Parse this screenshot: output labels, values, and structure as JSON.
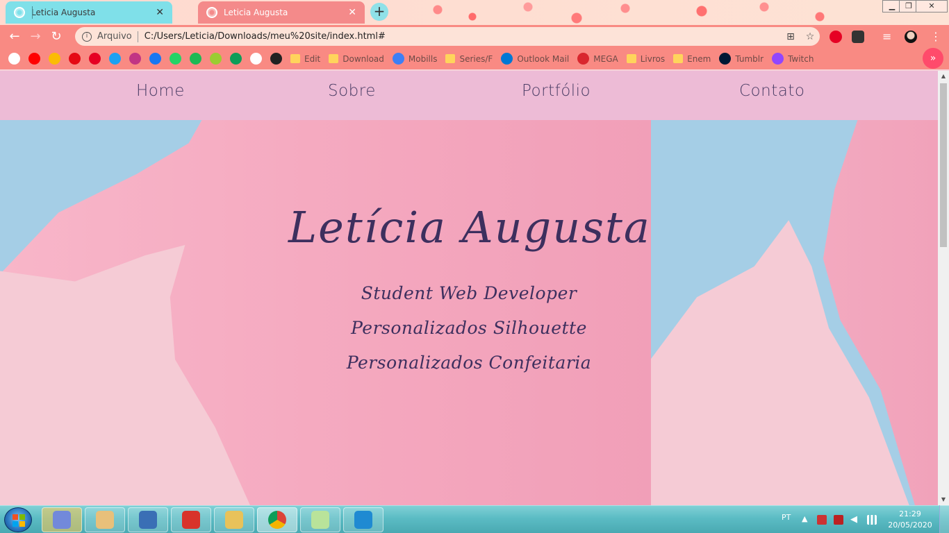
{
  "browser": {
    "tabs": [
      {
        "title": "Leticia Augusta",
        "active": false
      },
      {
        "title": "Leticia Augusta",
        "active": true
      }
    ],
    "new_tab_label": "+",
    "window_controls": {
      "minimize": "▁",
      "maximize": "❐",
      "close": "✕"
    },
    "nav": {
      "back": "←",
      "forward": "→",
      "reload": "↻"
    },
    "address": {
      "scheme_label": "Arquivo",
      "url": "C:/Users/Leticia/Downloads/meu%20site/index.html#"
    },
    "omnibox_icons": [
      "translate-icon",
      "star-icon"
    ],
    "bookmarks": [
      {
        "name": "google",
        "label": "",
        "color": "#ffffff"
      },
      {
        "name": "youtube",
        "label": "",
        "color": "#ff0000"
      },
      {
        "name": "photos",
        "label": "",
        "color": "#fbbc05"
      },
      {
        "name": "netflix",
        "label": "",
        "color": "#e50914"
      },
      {
        "name": "pinterest",
        "label": "",
        "color": "#e60023"
      },
      {
        "name": "twitter",
        "label": "",
        "color": "#1da1f2"
      },
      {
        "name": "instagram",
        "label": "",
        "color": "#c13584"
      },
      {
        "name": "facebook",
        "label": "",
        "color": "#1877f2"
      },
      {
        "name": "whatsapp",
        "label": "",
        "color": "#25d366"
      },
      {
        "name": "spotify",
        "label": "",
        "color": "#1db954"
      },
      {
        "name": "star",
        "label": "",
        "color": "#9acd32"
      },
      {
        "name": "drive",
        "label": "",
        "color": "#0f9d58"
      },
      {
        "name": "gmail",
        "label": "",
        "color": "#ffffff"
      },
      {
        "name": "t-app",
        "label": "",
        "color": "#222222"
      },
      {
        "name": "edit",
        "label": "Edit",
        "color": "folder"
      },
      {
        "name": "download",
        "label": "Download",
        "color": "folder"
      },
      {
        "name": "mobills",
        "label": "Mobills",
        "color": "#3d7ff5"
      },
      {
        "name": "series",
        "label": "Series/F",
        "color": "folder"
      },
      {
        "name": "outlook",
        "label": "Outlook Mail",
        "color": "#0078d4"
      },
      {
        "name": "mega",
        "label": "MEGA",
        "color": "#d9272e"
      },
      {
        "name": "livros",
        "label": "Livros",
        "color": "folder"
      },
      {
        "name": "enem",
        "label": "Enem",
        "color": "folder"
      },
      {
        "name": "tumblr",
        "label": "Tumblr",
        "color": "#001935"
      },
      {
        "name": "twitch",
        "label": "Twitch",
        "color": "#9146ff"
      }
    ],
    "bookmarks_more": "»"
  },
  "site": {
    "nav": [
      "Home",
      "Sobre",
      "Portfólio",
      "Contato"
    ],
    "hero": {
      "title": "Letícia Augusta",
      "lines": [
        "Student Web Developer",
        "Personalizados Silhouette",
        "Personalizados Confeitaria"
      ]
    }
  },
  "scrollbar": {
    "up": "▲",
    "down": "▼"
  },
  "taskbar": {
    "apps": [
      "discord",
      "paint",
      "on-screen-keyboard",
      "pdf",
      "file-explorer",
      "chrome",
      "sticky-notes",
      "vscode"
    ],
    "language": "PT",
    "time": "21:29",
    "date": "20/05/2020"
  }
}
